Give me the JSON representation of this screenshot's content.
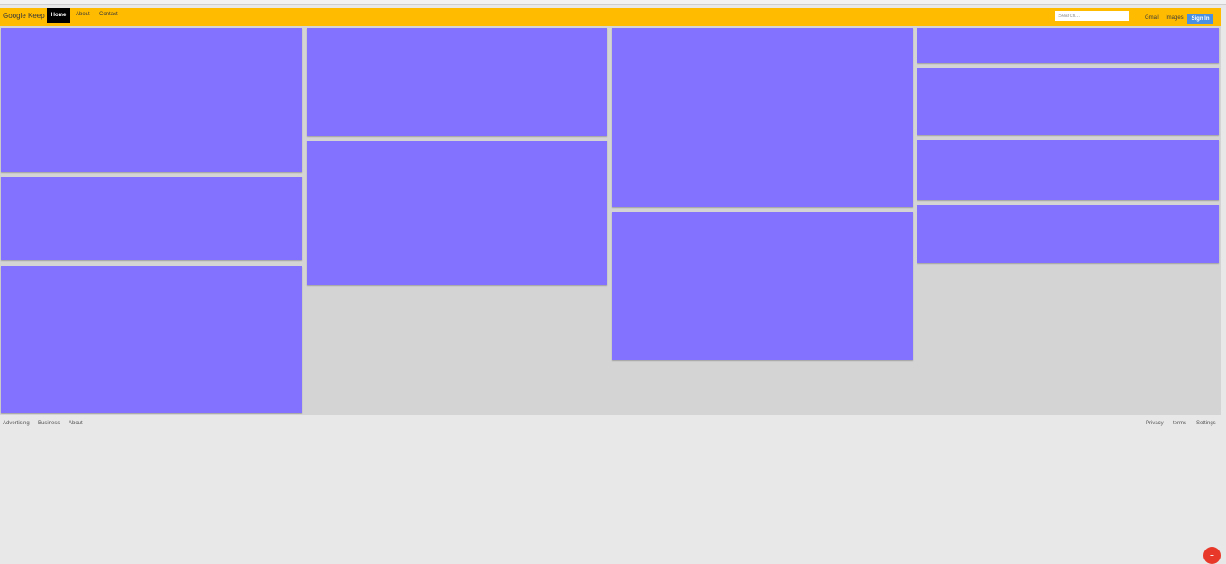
{
  "navbar": {
    "brand": "Google Keep",
    "home_label": "Home",
    "about_label": "About",
    "contact_label": "Contact",
    "search_placeholder": "Search...",
    "gmail_label": "Gmail",
    "images_label": "Images",
    "signin_label": "Sign In"
  },
  "footer": {
    "advertising_label": "Advertising",
    "business_label": "Business",
    "about_label": "About",
    "privacy_label": "Privacy",
    "terms_label": "terms",
    "settings_label": "Settings"
  },
  "fab": {
    "label": "+",
    "icon": "plus-icon"
  },
  "colors": {
    "navbar": "#ffbb00",
    "card": "#8372ff",
    "signin": "#4a90e2",
    "fab": "#e8382a"
  }
}
